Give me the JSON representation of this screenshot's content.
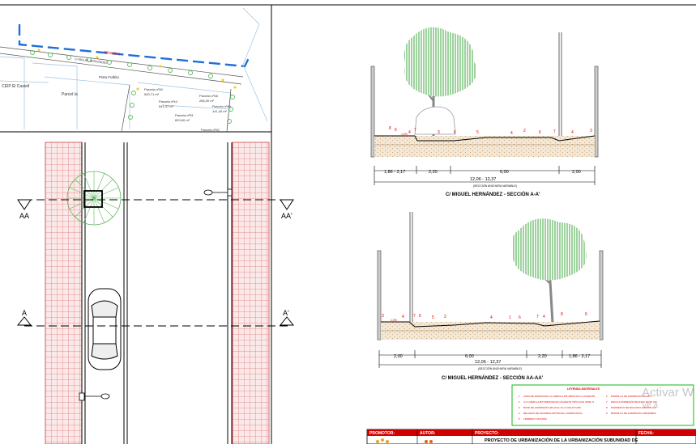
{
  "plan": {
    "labels": {
      "ceip": "CEIP El Castell",
      "parcel_main": "Parcel·la",
      "sports": "Pista Futbito",
      "tramo": "TRAMO A",
      "street_top": "C/ MIGUEL HERNÁNDEZ"
    },
    "parcels": [
      {
        "name": "Parcela nº40",
        "area": "540,71 m²"
      },
      {
        "name": "Parcela nº44",
        "area": "541,37 m²"
      },
      {
        "name": "Parcela nº51",
        "area": "820,60 m²"
      },
      {
        "name": "Parcela nº48",
        "area": "265,30 m²"
      },
      {
        "name": "Parcela nº49",
        "area": "141,40 m²"
      },
      {
        "name": "Parcela nº52",
        "area": ""
      }
    ]
  },
  "street_plan": {
    "section_marks": {
      "aa_left": "AA",
      "aa_right": "AA'",
      "a_left": "A",
      "a_right": "A'"
    }
  },
  "section_1": {
    "title": "C/ MIGUEL HERNÁNDEZ - SECCIÓN A-A'",
    "dims": {
      "left": "1,86 - 2,17",
      "d1": "2,20",
      "d2": "6,00",
      "d3": "2,00",
      "total": "12,06 - 12,37",
      "note": "(SECCIÓN ANCHURA VARIABLE)"
    },
    "markers": [
      "8",
      "6",
      "1,5%",
      "4",
      "7",
      "3",
      "6",
      "5",
      "4",
      "2",
      "6",
      "7",
      "4",
      "3"
    ]
  },
  "section_2": {
    "title": "C/ MIGUEL HERNÁNDEZ - SECCIÓN AA-AA'",
    "dims": {
      "d1": "2,00",
      "d2": "6,00",
      "d3": "2,20",
      "right": "1,86 - 2,17",
      "total": "12,06 - 12,37",
      "note": "(SECCIÓN ANCHURA VARIABLE)"
    },
    "markers": [
      "3",
      "4",
      "1,5%",
      "7",
      "6",
      "5",
      "2",
      "4",
      "1",
      "6",
      "7",
      "4",
      "8",
      "6"
    ]
  },
  "legend": {
    "title": "LEYENDA MATERIALES",
    "items": [
      {
        "num": "1",
        "text": "CAPA DE RODADURA con MEZCLA BITUMINOSA en CALIENTE"
      },
      {
        "num": "2",
        "text": "4 cm MEZCLA BITUMINOSA EN CALIENTE TIPO AC16 SURF S"
      },
      {
        "num": "3",
        "text": "BASE DE HORMIGÓN HM-20 de 15 cm DE ALTURA"
      },
      {
        "num": "4",
        "text": "RELLENO DE ZAHORRA ARTIFICIAL COMPACTADA"
      },
      {
        "num": "5",
        "text": "TERRENO NATURAL"
      },
      {
        "num": "6",
        "text": "BORDILLO DE HORMIGÓN BICAPA"
      },
      {
        "num": "7",
        "text": "RIGOLA HORMIGÓN BLANCO 30x30 CM"
      },
      {
        "num": "8",
        "text": "PAVIMENTO DE BALDOSA HIDRÁULICA"
      },
      {
        "num": "9",
        "text": "BORDILLO DE HORMIGÓN JARDINERA"
      }
    ]
  },
  "titleblock": {
    "promotor_label": "PROMOTOR:",
    "autor_label": "AUTOR:",
    "proyecto_label": "PROYECTO:",
    "fecha_label": "FECHA:",
    "proyecto_text": "PROYECTO DE URBANIZACIÓN DE LA URBANIZACIÓN SUBUNIDAD DE"
  },
  "watermark": {
    "line1": "Activar W",
    "line2": "Ve a"
  },
  "colors": {
    "accent_red": "#e00000",
    "tree_green": "#5cb85c",
    "frame_blue": "#1e6fd9",
    "legend_green": "#19b419",
    "paving_pink": "#f4c9c9"
  }
}
